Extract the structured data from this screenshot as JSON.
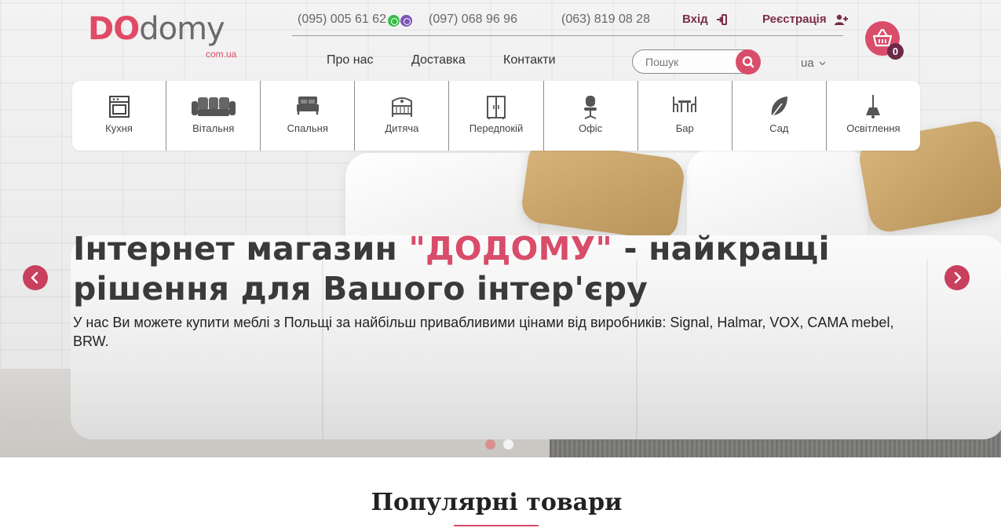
{
  "logo": {
    "brand_do": "DO",
    "brand_domy": "domy",
    "domain": "com.ua"
  },
  "contacts": {
    "phone_1": "(095) 005 61 62",
    "phone_2": "(097) 068 96 96",
    "phone_3": "(063) 819 08 28",
    "messenger_icons": [
      "whatsapp-icon",
      "viber-icon"
    ]
  },
  "auth": {
    "login": "Вхід",
    "register": "Реєстрація"
  },
  "nav": {
    "about": "Про нас",
    "delivery": "Доставка",
    "contacts": "Контакти"
  },
  "search": {
    "placeholder": "Пошук"
  },
  "language": {
    "current": "ua"
  },
  "cart": {
    "count": "0"
  },
  "categories": [
    {
      "label": "Кухня",
      "icon": "stove-icon"
    },
    {
      "label": "Вітальня",
      "icon": "sofa-icon"
    },
    {
      "label": "Спальня",
      "icon": "bed-icon"
    },
    {
      "label": "Дитяча",
      "icon": "crib-icon"
    },
    {
      "label": "Передпокій",
      "icon": "wardrobe-icon"
    },
    {
      "label": "Офіс",
      "icon": "office-chair-icon"
    },
    {
      "label": "Бар",
      "icon": "bar-table-icon"
    },
    {
      "label": "Сад",
      "icon": "leaf-icon"
    },
    {
      "label": "Освітлення",
      "icon": "lamp-icon"
    }
  ],
  "hero": {
    "title_before": "Інтернет магазин ",
    "title_accent": "\"ДОДОМУ\"",
    "title_after": " - найкращі рішення для Вашого інтер'єру",
    "subtitle": "У нас Ви можете купити меблі з Польщі за найбільш привабливими цінами від виробників: Signal, Halmar, VOX, CAMA mebel, BRW.",
    "active_slide": 1,
    "slides_total": 2
  },
  "popular": {
    "title": "Популярні товари"
  },
  "colors": {
    "accent": "#d94c6a",
    "dark_accent": "#7a2c49",
    "text": "#333333"
  }
}
